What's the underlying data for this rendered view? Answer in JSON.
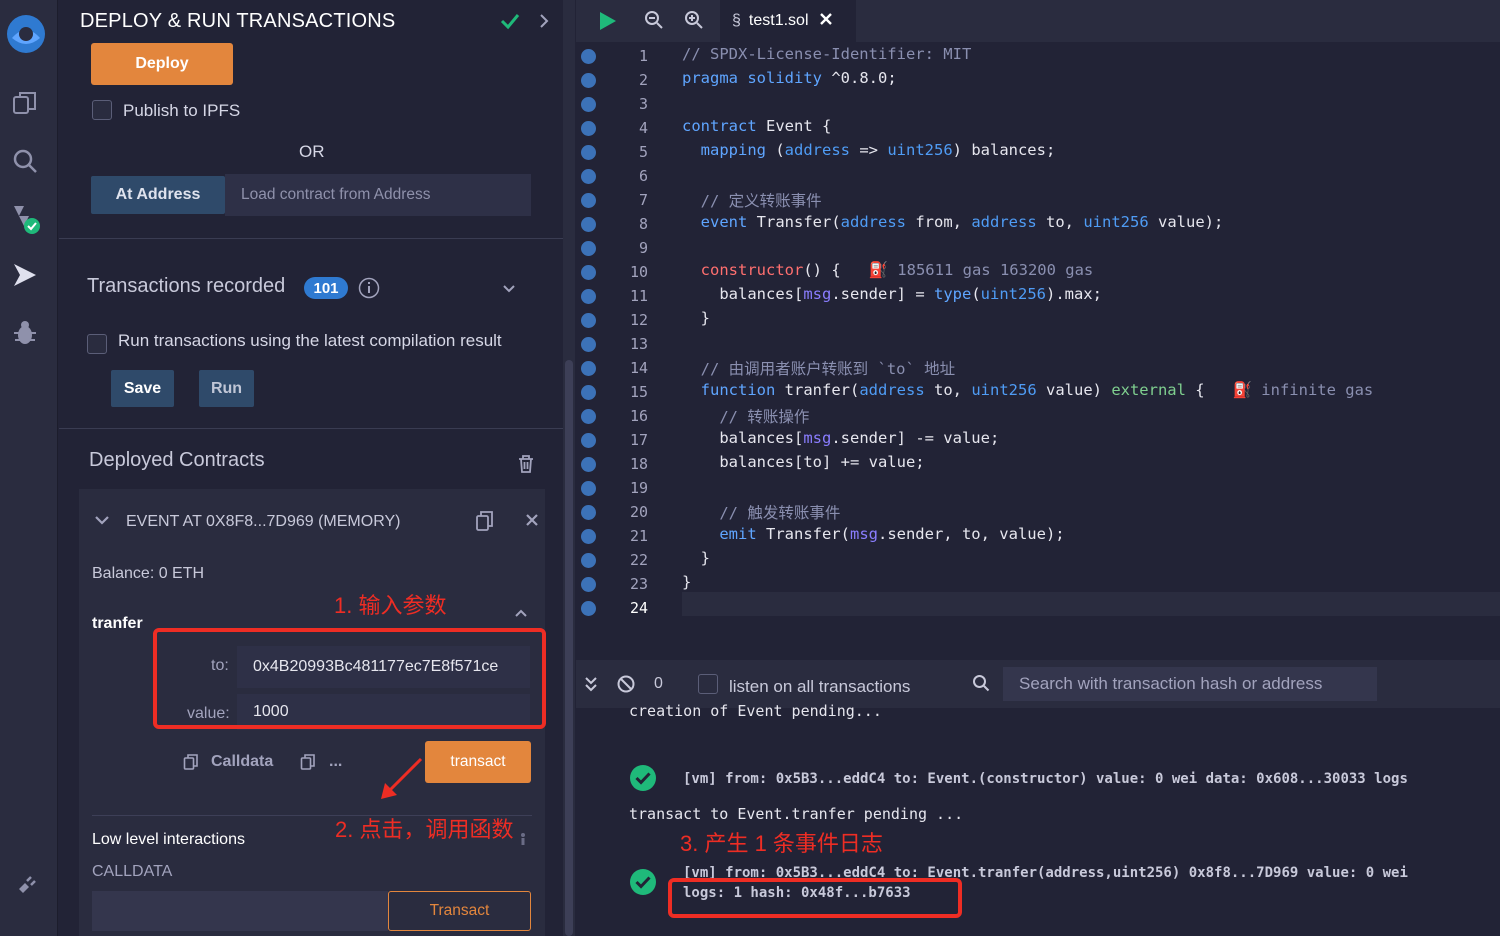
{
  "header": {
    "title": "DEPLOY & RUN TRANSACTIONS"
  },
  "deploy": {
    "deploy_label": "Deploy",
    "publish_label": "Publish to IPFS",
    "or_label": "OR",
    "at_address_label": "At Address",
    "at_address_placeholder": "Load contract from Address"
  },
  "transactions": {
    "title": "Transactions recorded",
    "count": "101",
    "run_latest_label": "Run transactions using the latest compilation result",
    "save_label": "Save",
    "run_label": "Run"
  },
  "deployed": {
    "title": "Deployed Contracts",
    "instance_title": "EVENT AT 0X8F8...7D969 (MEMORY)",
    "balance": "Balance: 0 ETH",
    "function_name": "tranfer",
    "to_label": "to:",
    "to_value": "0x4B20993Bc481177ec7E8f571ce",
    "value_label": "value:",
    "value_value": "1000",
    "calldata_label": "Calldata",
    "ellipsis": "...",
    "transact_label": "transact",
    "low_level_title": "Low level interactions",
    "calldata_caps": "CALLDATA",
    "transact_btn2": "Transact"
  },
  "annotations": {
    "step1": "1. 输入参数",
    "step2": "2. 点击，调用函数",
    "step3": "3. 产生 1 条事件日志"
  },
  "editor": {
    "tab_label": "test1.sol",
    "line_numbers": [
      "1",
      "2",
      "3",
      "4",
      "5",
      "6",
      "7",
      "8",
      "9",
      "10",
      "11",
      "12",
      "13",
      "14",
      "15",
      "16",
      "17",
      "18",
      "19",
      "20",
      "21",
      "22",
      "23",
      "24"
    ],
    "gas_constructor": "185611 gas 163200 gas",
    "gas_function": "infinite gas"
  },
  "terminal": {
    "count": "0",
    "listen_label": "listen on all transactions",
    "search_placeholder": "Search with transaction hash or address",
    "line_pending1": "creation of Event pending...",
    "line_vm1": "[vm]  from: 0x5B3...eddC4 to: Event.(constructor) value: 0 wei data: 0x608...30033 logs",
    "line_pending2": "transact to Event.tranfer pending ...",
    "line_vm2": "[vm]  from: 0x5B3...eddC4 to: Event.tranfer(address,uint256) 0x8f8...7D969 value: 0 wei",
    "line_vm2b": "logs: 1 hash: 0x48f...b7633"
  },
  "colors": {
    "accent_orange": "#e3863d",
    "button_blue": "#2f4a6a",
    "annotation_red": "#ee2d24",
    "success_green": "#1fb97a"
  }
}
